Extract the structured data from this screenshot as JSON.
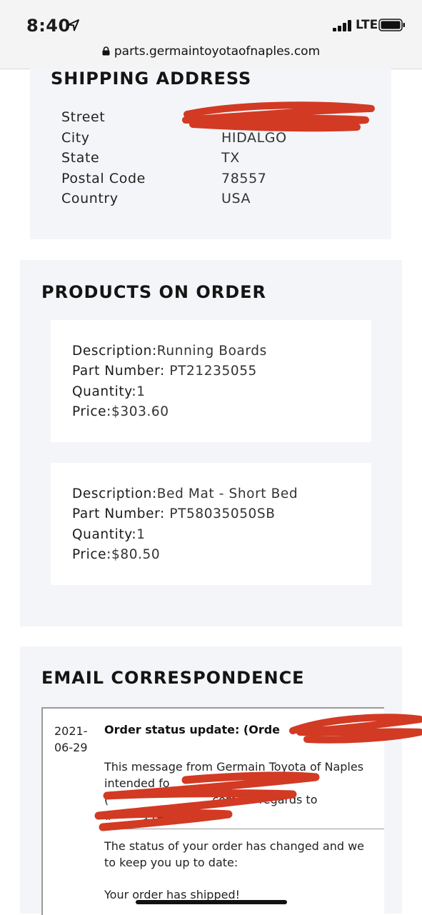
{
  "status_bar": {
    "time": "8:40",
    "network": "LTE",
    "url": "parts.germaintoyotaofnaples.com"
  },
  "shipping": {
    "title": "SHIPPING ADDRESS",
    "rows": [
      {
        "label": "Street",
        "value": ""
      },
      {
        "label": "City",
        "value": "HIDALGO"
      },
      {
        "label": "State",
        "value": "TX"
      },
      {
        "label": "Postal Code",
        "value": "78557"
      },
      {
        "label": "Country",
        "value": "USA"
      }
    ]
  },
  "products": {
    "title": "PRODUCTS ON ORDER",
    "labels": {
      "description": "Description:",
      "part_number": "Part Number:",
      "quantity": "Quantity:",
      "price": "Price:"
    },
    "items": [
      {
        "description": "Running Boards",
        "part_number": "PT21235055",
        "quantity": "1",
        "price": "$303.60"
      },
      {
        "description": "Bed Mat - Short Bed",
        "part_number": "PT58035050SB",
        "quantity": "1",
        "price": "$80.50"
      }
    ]
  },
  "email": {
    "title": "EMAIL CORRESPONDENCE",
    "messages": [
      {
        "date": "2021-06-29",
        "date_line1": "2021-",
        "date_line2": "06-29",
        "subject": "Order status update: (Orde",
        "body_lines": [
          "This message from Germain Toyota of Naples",
          "intended fo",
          "(",
          "#",
          "The status of your order has changed and we",
          "to keep you up to date:",
          "Your order has shipped!"
        ],
        "line3_tail": ".com) in regards to",
        "line4_tail": "114"
      }
    ]
  },
  "colors": {
    "panel_bg": "#f4f5f8",
    "redaction": "#d23a24",
    "card_bg": "#ffffff"
  }
}
